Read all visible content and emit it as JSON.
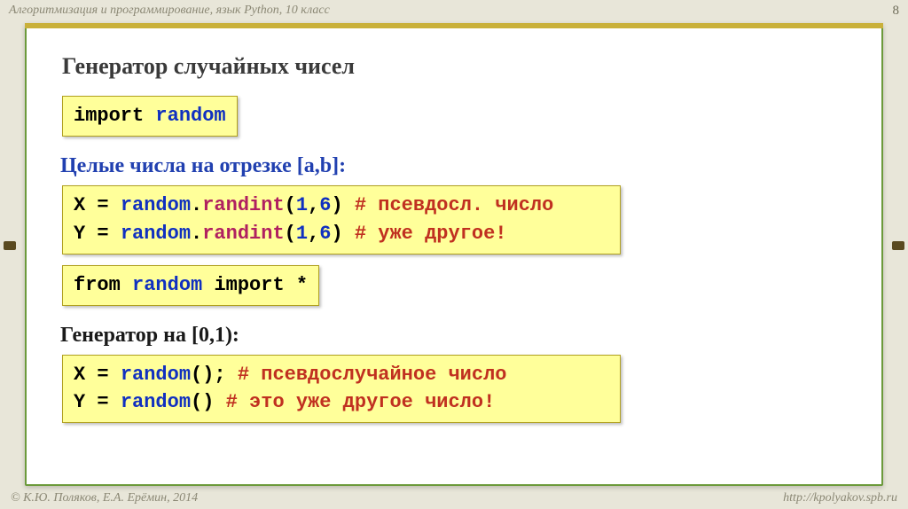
{
  "header": {
    "left": "Алгоритмизация и программирование, язык Python, 10 класс",
    "page_number": "8"
  },
  "footer": {
    "left": "© К.Ю. Поляков, Е.А. Ерёмин, 2014",
    "right": "http://kpolyakov.spb.ru"
  },
  "title": "Генератор случайных чисел",
  "block1": {
    "tokens": [
      {
        "t": "import ",
        "c": "kw"
      },
      {
        "t": "random",
        "c": "name"
      }
    ]
  },
  "sub1": "Целые числа на отрезке [a,b]:",
  "block2": {
    "lines": [
      [
        {
          "t": "X",
          "c": "plain"
        },
        {
          "t": " = ",
          "c": "plain"
        },
        {
          "t": "random",
          "c": "name"
        },
        {
          "t": ".",
          "c": "plain"
        },
        {
          "t": "randint",
          "c": "attr"
        },
        {
          "t": "(",
          "c": "plain"
        },
        {
          "t": "1",
          "c": "num"
        },
        {
          "t": ",",
          "c": "plain"
        },
        {
          "t": "6",
          "c": "num"
        },
        {
          "t": ") ",
          "c": "plain"
        },
        {
          "t": "# псевдосл. число",
          "c": "cmt"
        }
      ],
      [
        {
          "t": "Y",
          "c": "plain"
        },
        {
          "t": " = ",
          "c": "plain"
        },
        {
          "t": "random",
          "c": "name"
        },
        {
          "t": ".",
          "c": "plain"
        },
        {
          "t": "randint",
          "c": "attr"
        },
        {
          "t": "(",
          "c": "plain"
        },
        {
          "t": "1",
          "c": "num"
        },
        {
          "t": ",",
          "c": "plain"
        },
        {
          "t": "6",
          "c": "num"
        },
        {
          "t": ") ",
          "c": "plain"
        },
        {
          "t": "# уже другое!",
          "c": "cmt"
        }
      ]
    ]
  },
  "block3": {
    "tokens": [
      {
        "t": "from ",
        "c": "kw"
      },
      {
        "t": "random ",
        "c": "name"
      },
      {
        "t": "import ",
        "c": "kw"
      },
      {
        "t": "*",
        "c": "plain"
      }
    ]
  },
  "sub2": "Генератор на [0,1):",
  "block4": {
    "lines": [
      [
        {
          "t": "X",
          "c": "plain"
        },
        {
          "t": " = ",
          "c": "plain"
        },
        {
          "t": "random",
          "c": "name"
        },
        {
          "t": "(); ",
          "c": "plain"
        },
        {
          "t": "# псевдослучайное число",
          "c": "cmt"
        }
      ],
      [
        {
          "t": "Y",
          "c": "plain"
        },
        {
          "t": " = ",
          "c": "plain"
        },
        {
          "t": "random",
          "c": "name"
        },
        {
          "t": "()   ",
          "c": "plain"
        },
        {
          "t": "# это уже другое число!",
          "c": "cmt"
        }
      ]
    ]
  }
}
